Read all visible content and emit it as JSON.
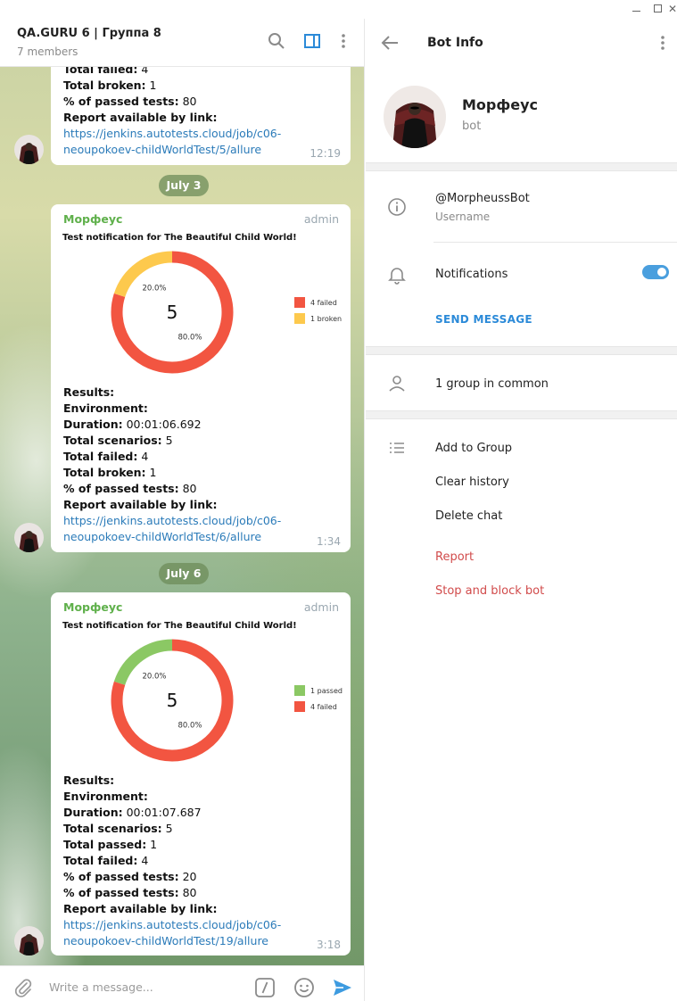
{
  "window": {
    "minimize": "minimize",
    "maximize": "maximize",
    "close": "close"
  },
  "chat": {
    "title": "QA.GURU 6 | Группа 8",
    "subtitle": "7 members",
    "composer_placeholder": "Write a message...",
    "messages": [
      {
        "lines": [
          {
            "label": "Total failed:",
            "value": " 4"
          },
          {
            "label": "Total broken:",
            "value": " 1"
          },
          {
            "label": "% of passed tests:",
            "value": " 80"
          },
          {
            "label": "Report available by link:",
            "value": ""
          }
        ],
        "link1": "https://jenkins.autotests.cloud/job/c06-",
        "link2": "neoupokoev-childWorldTest/5/allure",
        "time": "12:19"
      },
      {
        "date": "July 3",
        "sender": "Морфеус",
        "role": "admin",
        "notification_title": "Test notification for The Beautiful Child World!",
        "lines": [
          {
            "label": "Results:",
            "value": ""
          },
          {
            "label": "Environment:",
            "value": ""
          },
          {
            "label": "Duration:",
            "value": " 00:01:06.692"
          },
          {
            "label": "Total scenarios:",
            "value": " 5"
          },
          {
            "label": "Total failed:",
            "value": " 4"
          },
          {
            "label": "Total broken:",
            "value": " 1"
          },
          {
            "label": "% of passed tests:",
            "value": " 80"
          },
          {
            "label": "Report available by link:",
            "value": ""
          }
        ],
        "link1": "https://jenkins.autotests.cloud/job/c06-",
        "link2": "neoupokoev-childWorldTest/6/allure",
        "time": "1:34"
      },
      {
        "date": "July 6",
        "sender": "Морфеус",
        "role": "admin",
        "notification_title": "Test notification for The Beautiful Child World!",
        "lines": [
          {
            "label": "Results:",
            "value": ""
          },
          {
            "label": "Environment:",
            "value": ""
          },
          {
            "label": "Duration:",
            "value": " 00:01:07.687"
          },
          {
            "label": "Total scenarios:",
            "value": " 5"
          },
          {
            "label": "Total passed:",
            "value": " 1"
          },
          {
            "label": "Total failed:",
            "value": " 4"
          },
          {
            "label": "% of passed tests:",
            "value": " 20"
          },
          {
            "label": "% of passed tests:",
            "value": " 80"
          },
          {
            "label": "Report available by link:",
            "value": ""
          }
        ],
        "link1": "https://jenkins.autotests.cloud/job/c06-",
        "link2": "neoupokoev-childWorldTest/19/allure",
        "time": "3:18"
      }
    ]
  },
  "chart_data": [
    {
      "type": "pie",
      "center_label": "5",
      "slices": [
        {
          "name": "4 failed",
          "value": 80.0,
          "label": "80.0%",
          "color": "#f25541"
        },
        {
          "name": "1 broken",
          "value": 20.0,
          "label": "20.0%",
          "color": "#fdc94d"
        }
      ]
    },
    {
      "type": "pie",
      "center_label": "5",
      "slices": [
        {
          "name": "1 passed",
          "value": 20.0,
          "label": "20.0%",
          "color": "#8bc864"
        },
        {
          "name": "4 failed",
          "value": 80.0,
          "label": "80.0%",
          "color": "#f25541"
        }
      ]
    }
  ],
  "info": {
    "title": "Bot Info",
    "name": "Морфеус",
    "type": "bot",
    "username": "@MorpheussBot",
    "username_label": "Username",
    "notifications_label": "Notifications",
    "notifications_on": true,
    "send_message": "SEND MESSAGE",
    "groups_in_common": "1 group in common",
    "actions": [
      "Add to Group",
      "Clear history",
      "Delete chat"
    ],
    "danger_actions": [
      "Report",
      "Stop and block bot"
    ]
  },
  "colors": {
    "accent": "#2b8ad8",
    "sender": "#5fb04b",
    "danger": "#d14b4b",
    "link": "#2b7bb9"
  }
}
